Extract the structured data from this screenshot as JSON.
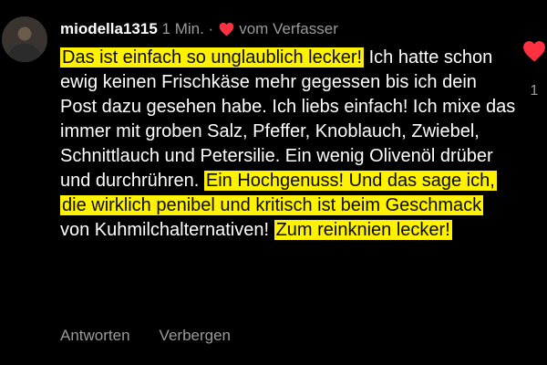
{
  "comment": {
    "username": "miodella1315",
    "time": "1 Min.",
    "separator": "·",
    "liked_by_author": "vom Verfasser",
    "segments": [
      {
        "text": "Das ist einfach so unglaublich lecker!",
        "highlight": true
      },
      {
        "text": " Ich hatte schon ewig keinen Frischkäse mehr gegessen bis ich dein Post dazu gesehen habe. Ich liebs einfach! Ich mixe das immer mit groben Salz, Pfeffer, Knoblauch, Zwiebel, Schnittlauch und Petersilie. Ein wenig Olivenöl drüber und durchrühren. ",
        "highlight": false
      },
      {
        "text": "Ein Hochgenuss! Und das sage ich, die wirklich penibel und kritisch ist beim Geschmack",
        "highlight": true
      },
      {
        "text": " von Kuhmilchalternativen! ",
        "highlight": false
      },
      {
        "text": "Zum reinknien lecker!",
        "highlight": true
      }
    ],
    "actions": {
      "reply": "Antworten",
      "hide": "Verbergen"
    },
    "like_count": "1"
  },
  "colors": {
    "background": "#000000",
    "heart": "#ff3040",
    "highlight": "#fff200",
    "meta_text": "#9a9a9a"
  },
  "icons": {
    "author_heart": "heart-icon",
    "like_heart": "heart-icon",
    "avatar": "avatar"
  }
}
